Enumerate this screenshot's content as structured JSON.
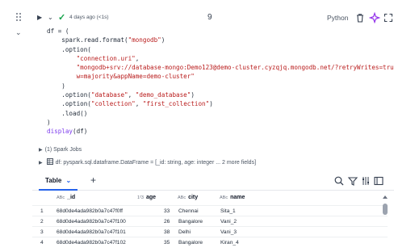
{
  "cell": {
    "exec_time": "4 days ago (<1s)",
    "exec_count": "9",
    "language": "Python"
  },
  "code_lines": [
    {
      "segments": [
        {
          "text": "df = (",
          "cls": "plain"
        }
      ]
    },
    {
      "segments": [
        {
          "text": "    spark.read.format(",
          "cls": "plain"
        },
        {
          "text": "\"mongodb\"",
          "cls": "str"
        },
        {
          "text": ")",
          "cls": "plain"
        }
      ]
    },
    {
      "segments": [
        {
          "text": "    .option(",
          "cls": "plain"
        }
      ]
    },
    {
      "segments": [
        {
          "text": "        ",
          "cls": "plain"
        },
        {
          "text": "\"connection.uri\"",
          "cls": "str"
        },
        {
          "text": ",",
          "cls": "plain"
        }
      ]
    },
    {
      "segments": [
        {
          "text": "        ",
          "cls": "plain"
        },
        {
          "text": "\"mongodb+srv://database-mongo:Demo123@demo-cluster.cyzqjq.mongodb.net/?retryWrites=true&",
          "cls": "str"
        }
      ]
    },
    {
      "segments": [
        {
          "text": "        ",
          "cls": "plain"
        },
        {
          "text": "w=majority&appName=demo-cluster\"",
          "cls": "str"
        }
      ]
    },
    {
      "segments": [
        {
          "text": "    )",
          "cls": "plain"
        }
      ]
    },
    {
      "segments": [
        {
          "text": "    .option(",
          "cls": "plain"
        },
        {
          "text": "\"database\"",
          "cls": "str"
        },
        {
          "text": ", ",
          "cls": "plain"
        },
        {
          "text": "\"demo_database\"",
          "cls": "str"
        },
        {
          "text": ")",
          "cls": "plain"
        }
      ]
    },
    {
      "segments": [
        {
          "text": "    .option(",
          "cls": "plain"
        },
        {
          "text": "\"collection\"",
          "cls": "str"
        },
        {
          "text": ", ",
          "cls": "plain"
        },
        {
          "text": "\"first_collection\"",
          "cls": "str"
        },
        {
          "text": ")",
          "cls": "plain"
        }
      ]
    },
    {
      "segments": [
        {
          "text": "    .load()",
          "cls": "plain"
        }
      ]
    },
    {
      "segments": [
        {
          "text": ")",
          "cls": "plain"
        }
      ]
    },
    {
      "segments": [
        {
          "text": "display",
          "cls": "purple"
        },
        {
          "text": "(df)",
          "cls": "plain"
        }
      ]
    }
  ],
  "output": {
    "spark_jobs": "(1) Spark Jobs",
    "df_label": "df:",
    "df_type": "pyspark.sql.dataframe.DataFrame = [_id: string, age: integer ... 2 more fields]"
  },
  "result": {
    "tab_label": "Table",
    "columns": [
      {
        "type": "ABc",
        "name": "_id"
      },
      {
        "type": "1²3",
        "name": "age"
      },
      {
        "type": "ABc",
        "name": "city"
      },
      {
        "type": "ABc",
        "name": "name"
      }
    ],
    "rows": [
      {
        "n": "1",
        "id": "68d0de4ada982b0a7c47f0ff",
        "age": "33",
        "city": "Chennai",
        "name": "Sita_1"
      },
      {
        "n": "2",
        "id": "68d0de4ada982b0a7c47f100",
        "age": "26",
        "city": "Bangalore",
        "name": "Vani_2"
      },
      {
        "n": "3",
        "id": "68d0de4ada982b0a7c47f101",
        "age": "38",
        "city": "Delhi",
        "name": "Vani_3"
      },
      {
        "n": "4",
        "id": "68d0de4ada982b0a7c47f102",
        "age": "35",
        "city": "Bangalore",
        "name": "Kiran_4"
      }
    ]
  },
  "colors": {
    "success": "#16a34a",
    "accent": "#2563eb",
    "string": "#b91c1c",
    "ai": "#9333ea"
  },
  "icons": [
    "drag-handle-icon",
    "chevron-down-icon",
    "play-icon",
    "check-icon",
    "trash-icon",
    "sparkle-icon",
    "expand-icon",
    "kebab-icon",
    "search-icon",
    "filter-icon",
    "column-settings-icon",
    "panel-icon"
  ]
}
